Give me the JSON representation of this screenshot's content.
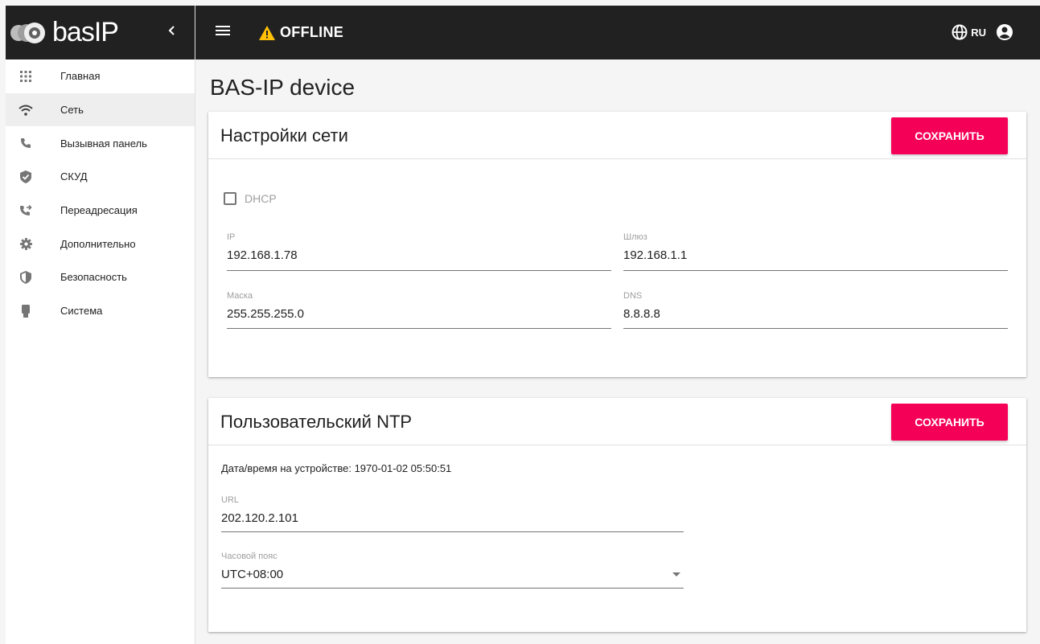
{
  "app": {
    "logo_text": "basIP",
    "status": "OFFLINE",
    "language": "RU"
  },
  "sidebar": {
    "items": [
      {
        "label": "Главная",
        "icon": "apps-grid-icon"
      },
      {
        "label": "Сеть",
        "icon": "wifi-icon"
      },
      {
        "label": "Вызывная панель",
        "icon": "phone-icon"
      },
      {
        "label": "СКУД",
        "icon": "shield-check-icon"
      },
      {
        "label": "Переадресация",
        "icon": "phone-forward-icon"
      },
      {
        "label": "Дополнительно",
        "icon": "gear-icon"
      },
      {
        "label": "Безопасность",
        "icon": "security-shield-icon"
      },
      {
        "label": "Система",
        "icon": "device-icon"
      }
    ]
  },
  "page": {
    "title": "BAS-IP device"
  },
  "network_card": {
    "title": "Настройки сети",
    "save_label": "СОХРАНИТЬ",
    "dhcp_label": "DHCP",
    "dhcp_checked": false,
    "ip": {
      "label": "IP",
      "value": "192.168.1.78"
    },
    "gateway": {
      "label": "Шлюз",
      "value": "192.168.1.1"
    },
    "mask": {
      "label": "Маска",
      "value": "255.255.255.0"
    },
    "dns": {
      "label": "DNS",
      "value": "8.8.8.8"
    }
  },
  "ntp_card": {
    "title": "Пользовательский NTP",
    "save_label": "СОХРАНИТЬ",
    "device_time": "Дата/время на устройстве: 1970-01-02 05:50:51",
    "url": {
      "label": "URL",
      "value": "202.120.2.101"
    },
    "timezone": {
      "label": "Часовой пояс",
      "value": "UTC+08:00"
    }
  },
  "colors": {
    "accent": "#f50057",
    "topbar": "#212121",
    "warning": "#ffc107"
  }
}
